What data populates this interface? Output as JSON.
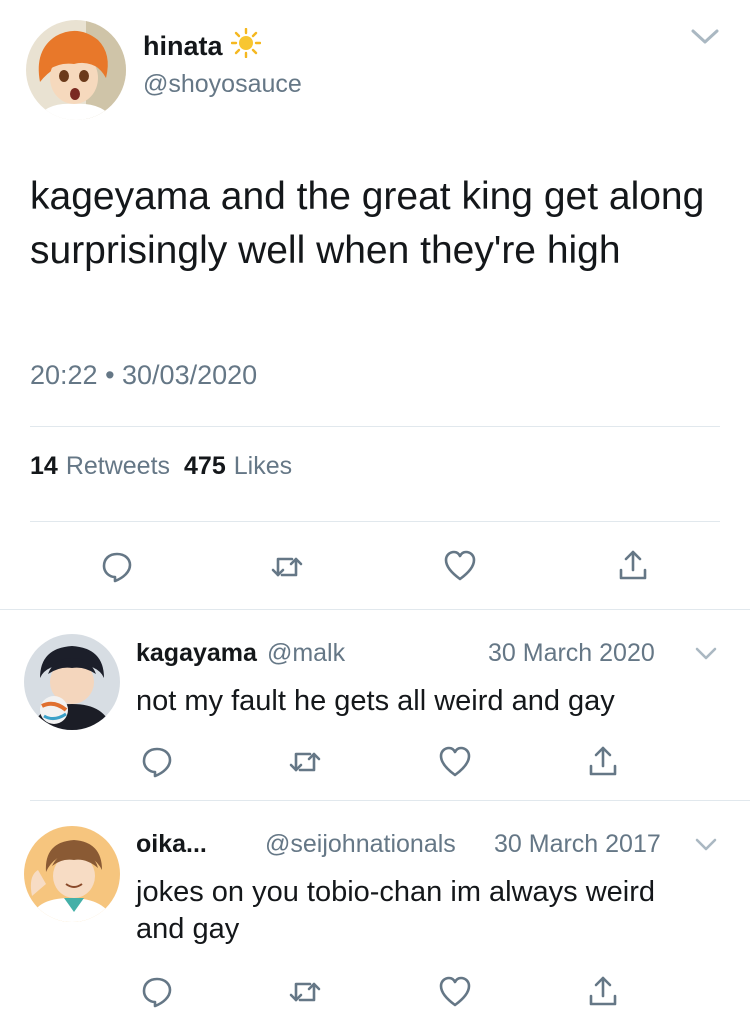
{
  "main_tweet": {
    "name": "hinata",
    "handle": "@shoyosauce",
    "text": "kageyama and the great king get along surprisingly well when they're high",
    "timestamp": "20:22 • 30/03/2020",
    "retweets_count": "14",
    "retweets_label": "Retweets",
    "likes_count": "475",
    "likes_label": "Likes",
    "name_emoji_icon": "sun-icon"
  },
  "replies": [
    {
      "name": "kagayama",
      "handle": "@malk",
      "date": "30 March 2020",
      "text": "not my fault he gets all weird and gay"
    },
    {
      "name": "oika...",
      "handle": "@seijohnationals",
      "date": "30 March 2017",
      "text": "jokes on you tobio-chan im always weird and gay"
    }
  ],
  "actions": [
    "reply-icon",
    "retweet-icon",
    "like-icon",
    "share-icon"
  ],
  "colors": {
    "secondary_text": "#657786",
    "divider": "#e1e8ed",
    "icon": "#657786"
  }
}
